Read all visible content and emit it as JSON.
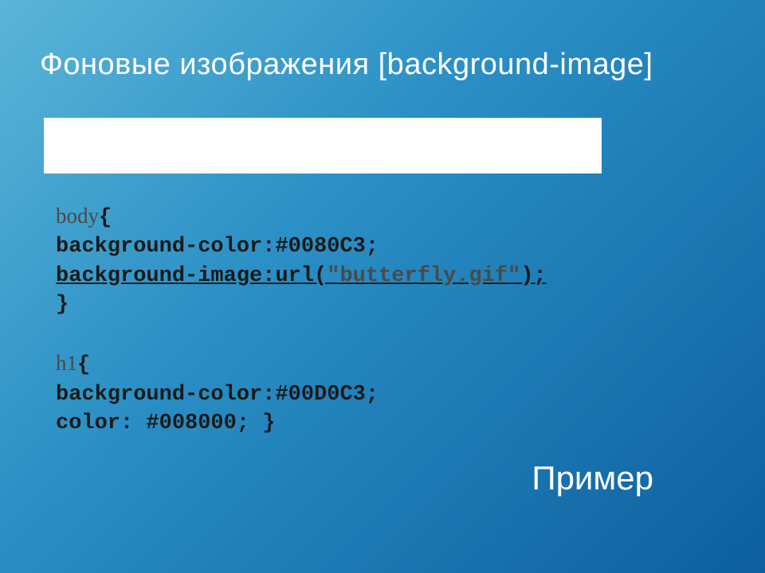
{
  "title": "Фоновые изображения [background-image]",
  "code": {
    "line1_a": "body",
    "line1_b": "{",
    "line2": "background-color:#0080C3;",
    "line3_a": "background-image:url(",
    "line3_b": "\"butterfly.gif\"",
    "line3_c": ");",
    "line4": "}",
    "line5_a": "h1",
    "line5_b": "{",
    "line6": "background-color:#00D0C3;",
    "line7": "color: #008000; }"
  },
  "example_label": "Пример"
}
